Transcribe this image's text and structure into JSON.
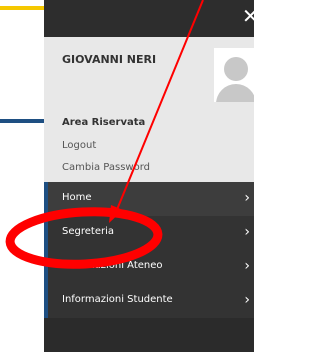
{
  "user": {
    "name": "GIOVANNI NERI",
    "area_title": "Area Riservata",
    "logout": "Logout",
    "change_password": "Cambia Password"
  },
  "menu": {
    "items": [
      {
        "label": "Home"
      },
      {
        "label": "Segreteria"
      },
      {
        "label": "Informazioni Ateneo"
      },
      {
        "label": "Informazioni Studente"
      }
    ]
  },
  "icons": {
    "close": "close-icon",
    "chevron": "chevron-right-icon",
    "avatar": "user-avatar-icon"
  },
  "colors": {
    "panel_bg": "#2b2b2b",
    "user_box_bg": "#e8e8e8",
    "accent_blue": "#1e4f82",
    "accent_yellow": "#f5c800",
    "annotation_red": "#ff0000"
  }
}
